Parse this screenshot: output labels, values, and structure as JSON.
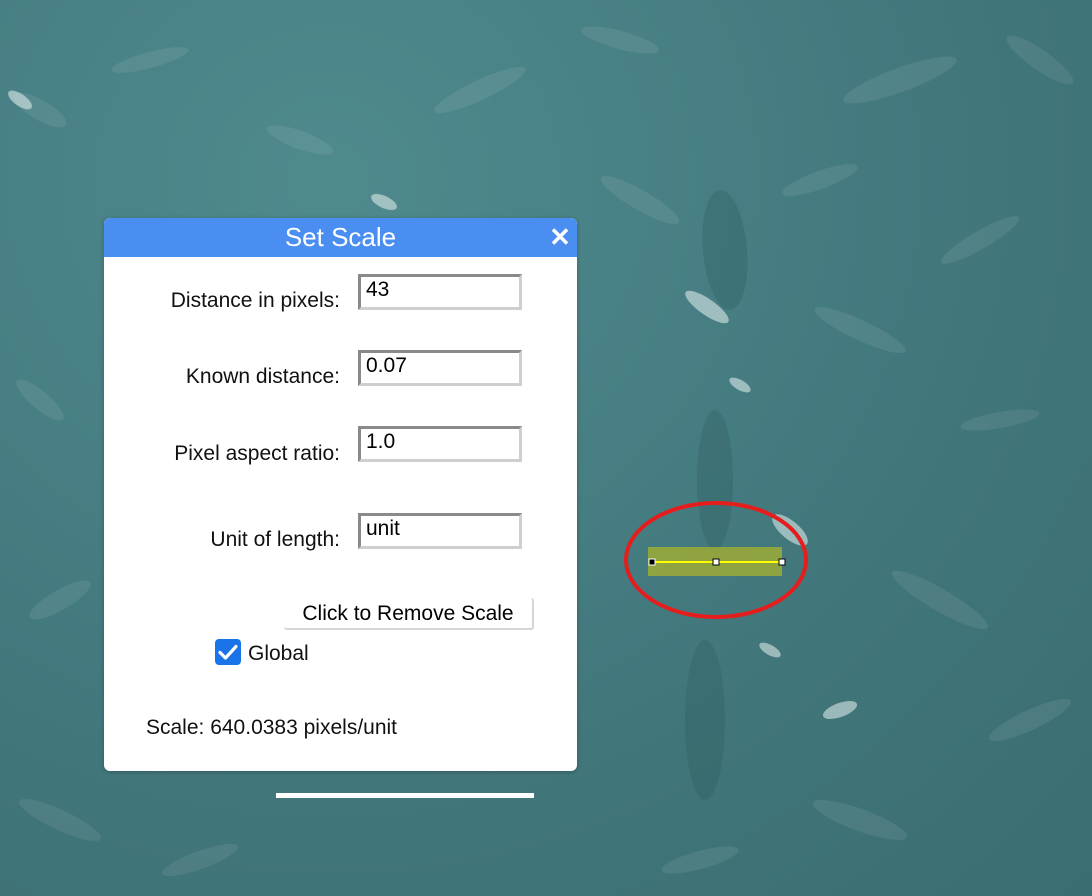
{
  "dialog": {
    "title": "Set Scale",
    "close_glyph": "✕",
    "fields": {
      "distance_label": "Distance in pixels:",
      "distance_value": "43",
      "known_label": "Known distance:",
      "known_value": "0.07",
      "aspect_label": "Pixel aspect ratio:",
      "aspect_value": "1.0",
      "unit_label": "Unit of length:",
      "unit_value": "unit"
    },
    "remove_label": "Click to Remove Scale",
    "global_label": "Global",
    "global_checked": true,
    "scale_text": "Scale: 640.0383 pixels/unit"
  },
  "colors": {
    "title_bar": "#4a8ef2",
    "checkbox": "#1a73e8",
    "selection_line": "#ffff00",
    "highlight_ellipse": "#e41d1d",
    "water": "#477f84"
  },
  "icons": {
    "close": "close-icon",
    "check": "checkmark-icon"
  }
}
